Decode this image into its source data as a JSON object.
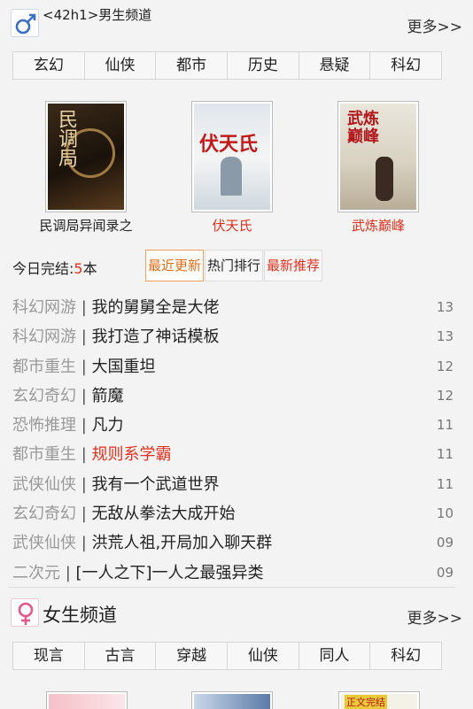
{
  "male": {
    "title": "<42h1>男生频道",
    "more": "更多>>",
    "genres": [
      "玄幻",
      "仙侠",
      "都市",
      "历史",
      "悬疑",
      "科幻"
    ]
  },
  "featured": [
    {
      "title": "民调局异闻录之",
      "cover_text": "民调局",
      "color": "#222"
    },
    {
      "title": "伏天氏",
      "cover_text": "伏天氏",
      "color": "#e0301e"
    },
    {
      "title": "武炼巅峰",
      "cover_text": "武炼巅峰",
      "color": "#e0301e"
    }
  ],
  "completed": {
    "label": "今日完结:",
    "count": "5",
    "unit": "本"
  },
  "tabs": [
    "最近更新",
    "热门排行",
    "最新推荐"
  ],
  "list": [
    {
      "cat": "科幻网游",
      "title": "我的舅舅全是大佬",
      "time": "13"
    },
    {
      "cat": "科幻网游",
      "title": "我打造了神话模板",
      "time": "13"
    },
    {
      "cat": "都市重生",
      "title": "大国重坦",
      "time": "12"
    },
    {
      "cat": "玄幻奇幻",
      "title": "箭魔",
      "time": "12"
    },
    {
      "cat": "恐怖推理",
      "title": "凡力",
      "time": "11"
    },
    {
      "cat": "都市重生",
      "title": "规则系学霸",
      "time": "11",
      "hot": true
    },
    {
      "cat": "武侠仙侠",
      "title": "我有一个武道世界",
      "time": "11"
    },
    {
      "cat": "玄幻奇幻",
      "title": "无敌从拳法大成开始",
      "time": "10"
    },
    {
      "cat": "武侠仙侠",
      "title": "洪荒人祖,开局加入聊天群",
      "time": "09"
    },
    {
      "cat": "二次元",
      "title": "[一人之下]一人之最强异类",
      "time": "09"
    }
  ],
  "female": {
    "title": "女生频道",
    "more": "更多>>",
    "genres": [
      "现言",
      "古言",
      "穿越",
      "仙侠",
      "同人",
      "科幻"
    ]
  },
  "partial_covers": [
    "",
    "",
    "正文完结"
  ],
  "colors": {
    "accent": "#e0301e",
    "orange": "#e26b16",
    "male_icon": "#3a6fc4",
    "female_icon": "#e05a8a"
  },
  "icons": {
    "male": "male-symbol-icon",
    "female": "female-symbol-icon"
  }
}
